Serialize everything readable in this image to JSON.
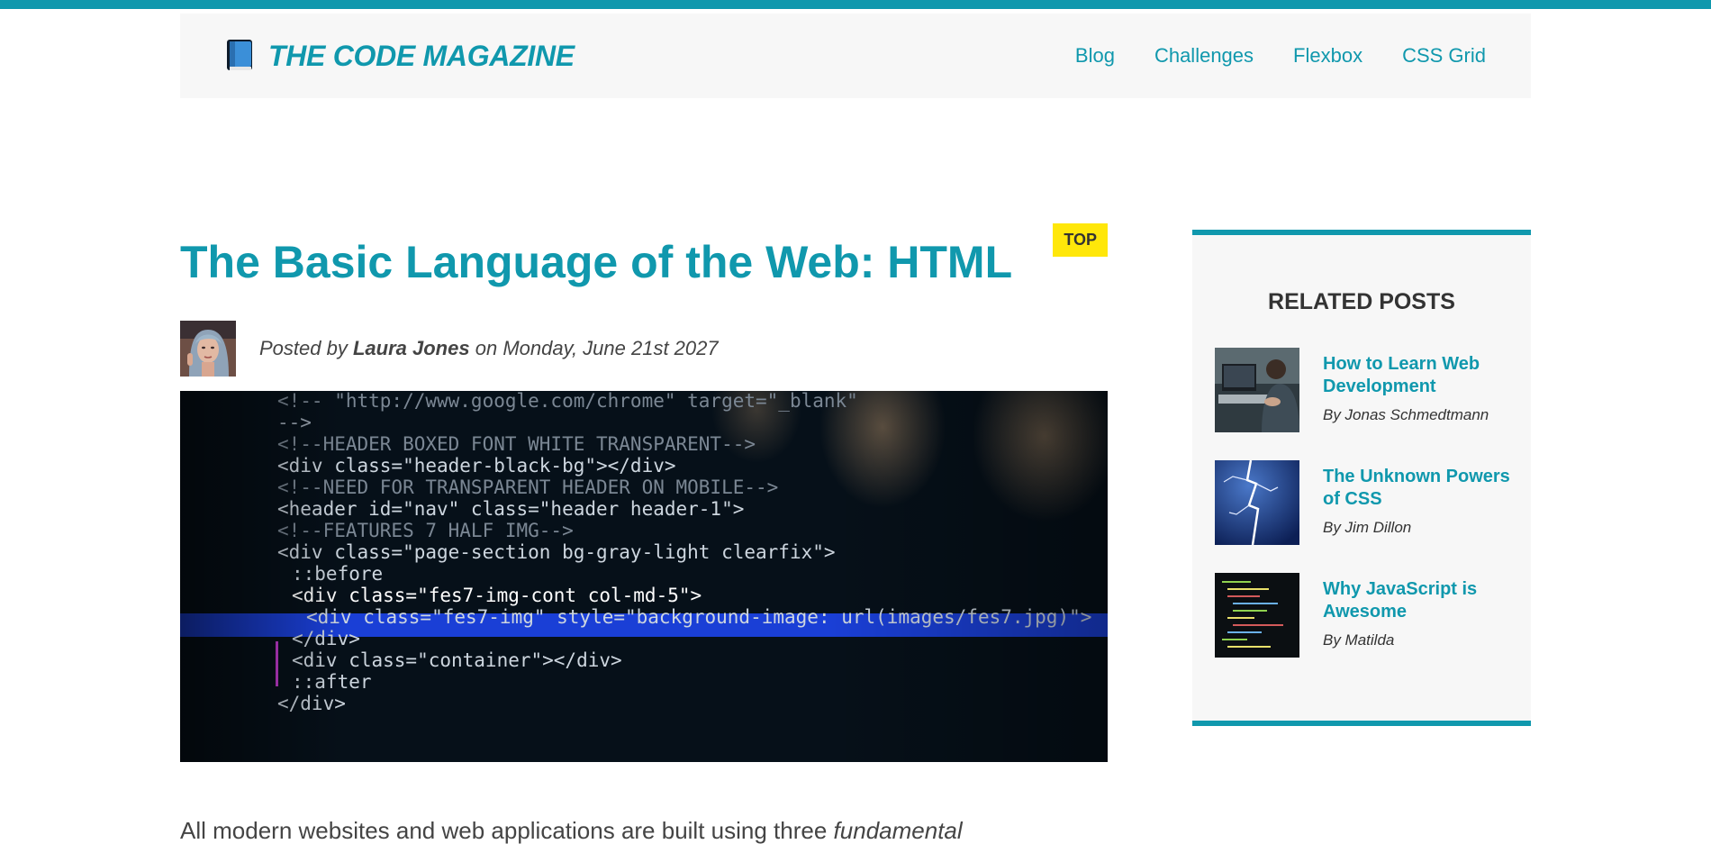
{
  "header": {
    "brand": "THE CODE MAGAZINE",
    "nav": [
      {
        "label": "Blog"
      },
      {
        "label": "Challenges"
      },
      {
        "label": "Flexbox"
      },
      {
        "label": "CSS Grid"
      }
    ]
  },
  "post": {
    "tag": "TOP",
    "title": "The Basic Language of the Web: HTML",
    "byline_prefix": "Posted by",
    "author": "Laura Jones",
    "byline_middle": "on",
    "date": "Monday, June 21st 2027",
    "intro_text": "All modern websites and web applications are built using three",
    "intro_emph": "fundamental"
  },
  "hero_code": [
    {
      "text": "<!-- \"http://www.google.com/chrome\" target=\"_blank\"",
      "color": "#7b8794",
      "indent": 1
    },
    {
      "text": "-->",
      "color": "#9aa5b1",
      "indent": 1
    },
    {
      "text": "<!--HEADER BOXED FONT WHITE TRANSPARENT-->",
      "color": "#7b8794",
      "indent": 1
    },
    {
      "text": "<div class=\"header-black-bg\"></div>",
      "color": "#cdd6df",
      "indent": 1
    },
    {
      "text": "<!--NEED FOR TRANSPARENT HEADER ON MOBILE-->",
      "color": "#7b8794",
      "indent": 1
    },
    {
      "text": "<header id=\"nav\" class=\"header header-1\">",
      "color": "#cdd6df",
      "indent": 1
    },
    {
      "text": "<!--FEATURES 7 HALF IMG-->",
      "color": "#7b8794",
      "indent": 1
    },
    {
      "text": "<div class=\"page-section bg-gray-light clearfix\">",
      "color": "#cdd6df",
      "indent": 1
    },
    {
      "text": "::before",
      "color": "#cdd6df",
      "indent": 2
    },
    {
      "text": "<div class=\"fes7-img-cont col-md-5\">",
      "color": "#ffffff",
      "indent": 2
    },
    {
      "text": "<div class=\"fes7-img\" style=\"background-image: url(images/fes7.jpg)\">",
      "color": "#cdd6df",
      "indent": 3
    },
    {
      "text": "</div>",
      "color": "#cdd6df",
      "indent": 2
    },
    {
      "text": "<div class=\"container\"></div>",
      "color": "#cdd6df",
      "indent": 2
    },
    {
      "text": "::after",
      "color": "#cdd6df",
      "indent": 2
    },
    {
      "text": "</div>",
      "color": "#cdd6df",
      "indent": 1
    }
  ],
  "aside": {
    "title": "Related posts",
    "posts": [
      {
        "title": "How to Learn Web Development",
        "author": "By Jonas Schmedtmann"
      },
      {
        "title": "The Unknown Powers of CSS",
        "author": "By Jim Dillon"
      },
      {
        "title": "Why JavaScript is Awesome",
        "author": "By Matilda"
      }
    ]
  },
  "colors": {
    "accent": "#1098ad",
    "tag_bg": "#ffe70a",
    "panel_bg": "#f7f7f7",
    "text": "#444444"
  }
}
